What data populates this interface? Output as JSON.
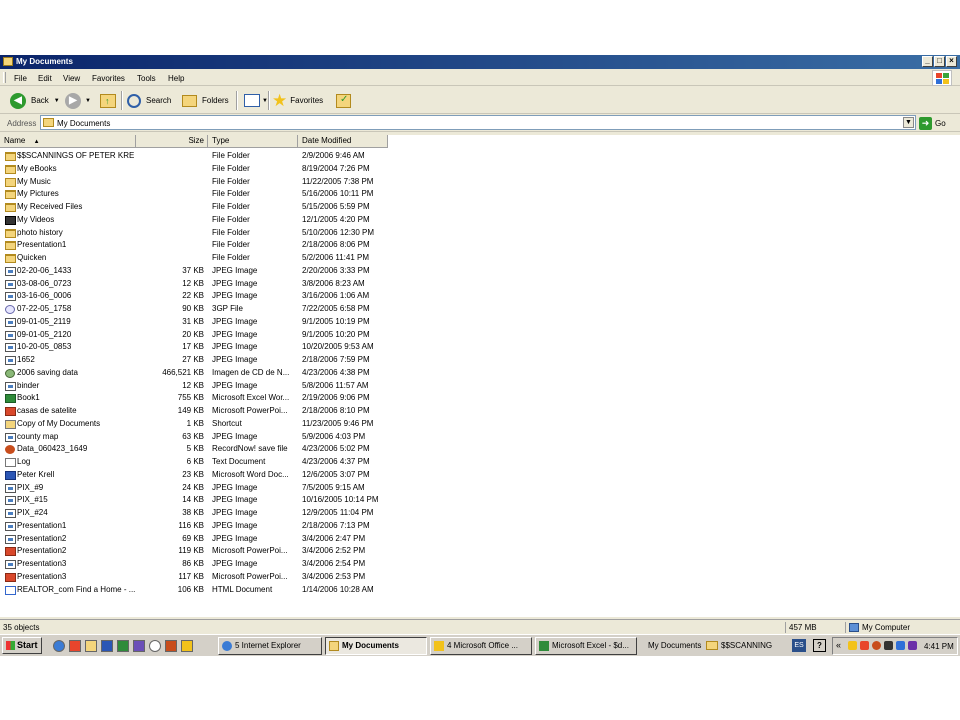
{
  "window": {
    "title": "My Documents",
    "controls": [
      "_",
      "□",
      "×"
    ]
  },
  "menu": [
    "File",
    "Edit",
    "View",
    "Favorites",
    "Tools",
    "Help"
  ],
  "toolbar": {
    "back": "Back",
    "search": "Search",
    "folders": "Folders",
    "favorites": "Favorites"
  },
  "address": {
    "label": "Address",
    "value": "My Documents",
    "go": "Go"
  },
  "columns": {
    "name": "Name",
    "size": "Size",
    "type": "Type",
    "date": "Date Modified"
  },
  "files": [
    {
      "name": "$$SCANNINGS OF PETER KRELL",
      "size": "",
      "type": "File Folder",
      "date": "2/9/2006 9:46 AM",
      "icon": "folder-icon"
    },
    {
      "name": "My eBooks",
      "size": "",
      "type": "File Folder",
      "date": "8/19/2004 7:26 PM",
      "icon": "folder-icon"
    },
    {
      "name": "My Music",
      "size": "",
      "type": "File Folder",
      "date": "11/22/2005 7:38 PM",
      "icon": "music-folder-icon"
    },
    {
      "name": "My Pictures",
      "size": "",
      "type": "File Folder",
      "date": "5/16/2006 10:11 PM",
      "icon": "folder-icon"
    },
    {
      "name": "My Received Files",
      "size": "",
      "type": "File Folder",
      "date": "5/15/2006 5:59 PM",
      "icon": "folder-icon"
    },
    {
      "name": "My Videos",
      "size": "",
      "type": "File Folder",
      "date": "12/1/2005 4:20 PM",
      "icon": "video-folder-icon"
    },
    {
      "name": "photo history",
      "size": "",
      "type": "File Folder",
      "date": "5/10/2006 12:30 PM",
      "icon": "folder-icon"
    },
    {
      "name": "Presentation1",
      "size": "",
      "type": "File Folder",
      "date": "2/18/2006 8:06 PM",
      "icon": "folder-icon"
    },
    {
      "name": "Quicken",
      "size": "",
      "type": "File Folder",
      "date": "5/2/2006 11:41 PM",
      "icon": "folder-icon"
    },
    {
      "name": "02-20-06_1433",
      "size": "37 KB",
      "type": "JPEG Image",
      "date": "2/20/2006 3:33 PM",
      "icon": "jpeg-icon"
    },
    {
      "name": "03-08-06_0723",
      "size": "12 KB",
      "type": "JPEG Image",
      "date": "3/8/2006 8:23 AM",
      "icon": "jpeg-icon"
    },
    {
      "name": "03-16-06_0006",
      "size": "22 KB",
      "type": "JPEG Image",
      "date": "3/16/2006 1:06 AM",
      "icon": "jpeg-icon"
    },
    {
      "name": "07-22-05_1758",
      "size": "90 KB",
      "type": "3GP File",
      "date": "7/22/2005 6:58 PM",
      "icon": "3gp-icon"
    },
    {
      "name": "09-01-05_2119",
      "size": "31 KB",
      "type": "JPEG Image",
      "date": "9/1/2005 10:19 PM",
      "icon": "jpeg-icon"
    },
    {
      "name": "09-01-05_2120",
      "size": "20 KB",
      "type": "JPEG Image",
      "date": "9/1/2005 10:20 PM",
      "icon": "jpeg-icon"
    },
    {
      "name": "10-20-05_0853",
      "size": "17 KB",
      "type": "JPEG Image",
      "date": "10/20/2005 9:53 AM",
      "icon": "jpeg-icon"
    },
    {
      "name": "1652",
      "size": "27 KB",
      "type": "JPEG Image",
      "date": "2/18/2006 7:59 PM",
      "icon": "jpeg-icon"
    },
    {
      "name": "2006 saving data",
      "size": "466,521 KB",
      "type": "Imagen de CD de N...",
      "date": "4/23/2006 4:38 PM",
      "icon": "cd-image-icon"
    },
    {
      "name": "binder",
      "size": "12 KB",
      "type": "JPEG Image",
      "date": "5/8/2006 11:57 AM",
      "icon": "jpeg-icon"
    },
    {
      "name": "Book1",
      "size": "755 KB",
      "type": "Microsoft Excel Wor...",
      "date": "2/19/2006 9:06 PM",
      "icon": "excel-icon"
    },
    {
      "name": "casas de satelite",
      "size": "149 KB",
      "type": "Microsoft PowerPoi...",
      "date": "2/18/2006 8:10 PM",
      "icon": "powerpoint-icon"
    },
    {
      "name": "Copy of My Documents",
      "size": "1 KB",
      "type": "Shortcut",
      "date": "11/23/2005 9:46 PM",
      "icon": "shortcut-icon"
    },
    {
      "name": "county map",
      "size": "63 KB",
      "type": "JPEG Image",
      "date": "5/9/2006 4:03 PM",
      "icon": "jpeg-icon"
    },
    {
      "name": "Data_060423_1649",
      "size": "5 KB",
      "type": "RecordNow! save file",
      "date": "4/23/2006 5:02 PM",
      "icon": "recordnow-icon"
    },
    {
      "name": "Log",
      "size": "6 KB",
      "type": "Text Document",
      "date": "4/23/2006 4:37 PM",
      "icon": "text-icon"
    },
    {
      "name": "Peter Krell",
      "size": "23 KB",
      "type": "Microsoft Word Doc...",
      "date": "12/6/2005 3:07 PM",
      "icon": "word-icon"
    },
    {
      "name": "PIX_#9",
      "size": "24 KB",
      "type": "JPEG Image",
      "date": "7/5/2005 9:15 AM",
      "icon": "jpeg-icon"
    },
    {
      "name": "PIX_#15",
      "size": "14 KB",
      "type": "JPEG Image",
      "date": "10/16/2005 10:14 PM",
      "icon": "jpeg-icon"
    },
    {
      "name": "PIX_#24",
      "size": "38 KB",
      "type": "JPEG Image",
      "date": "12/9/2005 11:04 PM",
      "icon": "jpeg-icon"
    },
    {
      "name": "Presentation1",
      "size": "116 KB",
      "type": "JPEG Image",
      "date": "2/18/2006 7:13 PM",
      "icon": "jpeg-icon"
    },
    {
      "name": "Presentation2",
      "size": "69 KB",
      "type": "JPEG Image",
      "date": "3/4/2006 2:47 PM",
      "icon": "jpeg-icon"
    },
    {
      "name": "Presentation2",
      "size": "119 KB",
      "type": "Microsoft PowerPoi...",
      "date": "3/4/2006 2:52 PM",
      "icon": "powerpoint-icon"
    },
    {
      "name": "Presentation3",
      "size": "86 KB",
      "type": "JPEG Image",
      "date": "3/4/2006 2:54 PM",
      "icon": "jpeg-icon"
    },
    {
      "name": "Presentation3",
      "size": "117 KB",
      "type": "Microsoft PowerPoi...",
      "date": "3/4/2006 2:53 PM",
      "icon": "powerpoint-icon"
    },
    {
      "name": "REALTOR_com Find a Home - ...",
      "size": "106 KB",
      "type": "HTML Document",
      "date": "1/14/2006 10:28 AM",
      "icon": "html-icon"
    }
  ],
  "status": {
    "count": "35 objects",
    "size": "457 MB",
    "location": "My Computer"
  },
  "taskbar": {
    "start": "Start",
    "tasks": [
      {
        "label": "5 Internet Explorer",
        "active": false
      },
      {
        "label": "My Documents",
        "active": true
      },
      {
        "label": "4 Microsoft Office ...",
        "active": false
      },
      {
        "label": "Microsoft Excel - $d...",
        "active": false
      }
    ],
    "deskband": [
      "My Documents",
      "$$SCANNING"
    ],
    "lang": "ES",
    "help": "?",
    "chevron": "«",
    "time": "4:41 PM"
  },
  "colors": {
    "titlebar_start": "#0a246a",
    "titlebar_end": "#3a6ea5",
    "chrome": "#ece9d8",
    "taskbar": "#d4d0c8"
  }
}
